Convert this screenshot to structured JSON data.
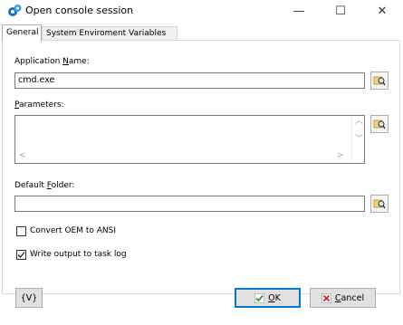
{
  "window": {
    "title": "Open console session",
    "minimize": "—",
    "maximize": "☐",
    "close": "✕"
  },
  "tabs": [
    {
      "label": "General"
    },
    {
      "label": "System Enviroment Variables"
    }
  ],
  "app_name": {
    "label_pre": "Application ",
    "label_key": "N",
    "label_post": "ame:",
    "value": "cmd.exe"
  },
  "parameters": {
    "label_key": "P",
    "label_post": "arameters:",
    "value": ""
  },
  "default_folder": {
    "label_pre": "Default ",
    "label_key": "F",
    "label_post": "older:",
    "value": ""
  },
  "options": {
    "convert_oem": {
      "label": "Convert OEM to ANSI",
      "checked": false
    },
    "write_output": {
      "label": "Write output to task log",
      "checked": true
    }
  },
  "buttons": {
    "variables": "{V}",
    "ok_key": "O",
    "ok_post": "K",
    "cancel_key": "C",
    "cancel_post": "ancel"
  },
  "colors": {
    "ok_check": "#2e9d2e",
    "cancel_x": "#d42020",
    "accent": "#0078d7"
  }
}
